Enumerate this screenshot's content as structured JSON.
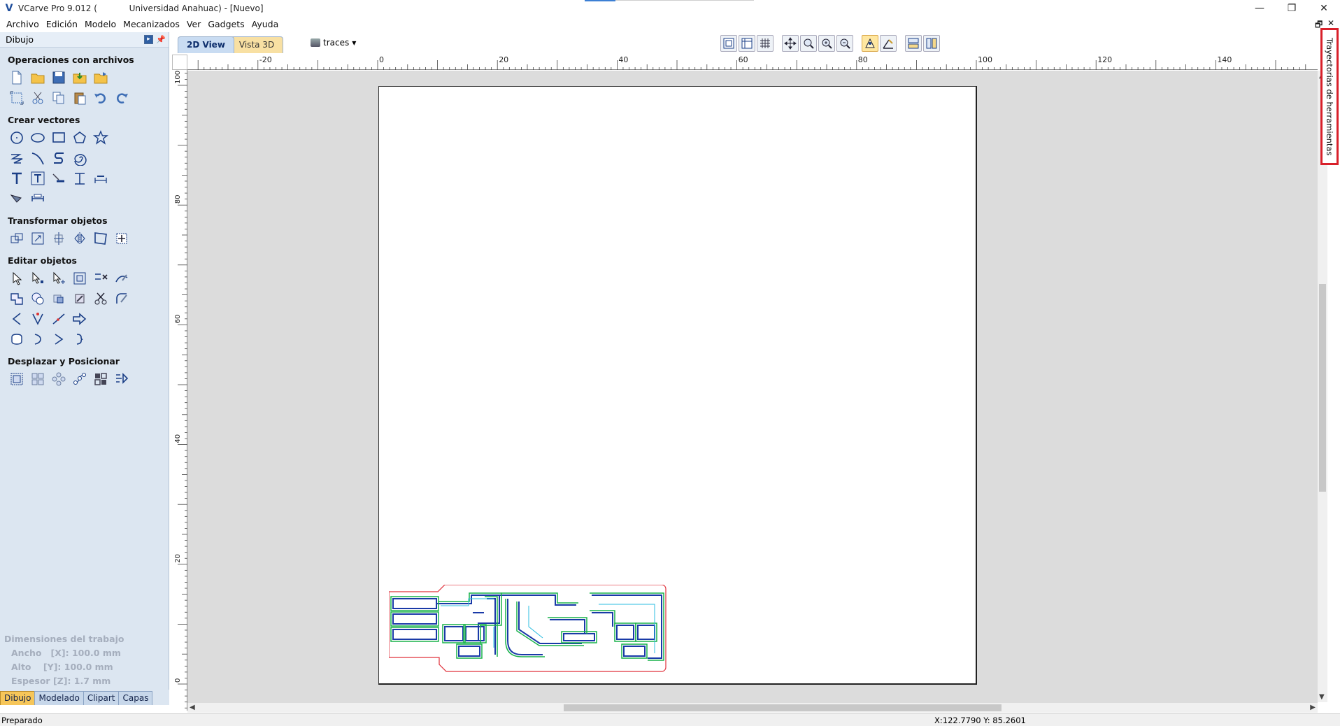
{
  "window": {
    "title": "VCarve Pro 9.012 (            Universidad Anahuac) - [Nuevo]",
    "minimize": "—",
    "maximize": "❐",
    "close": "✕"
  },
  "menu": {
    "items": [
      "Archivo",
      "Edición",
      "Modelo",
      "Mecanizados",
      "Ver",
      "Gadgets",
      "Ayuda"
    ],
    "restore": "🗗",
    "close": "✕"
  },
  "left_panel": {
    "title": "Dibujo",
    "sections": [
      {
        "title": "Operaciones con archivos"
      },
      {
        "title": "Crear vectores"
      },
      {
        "title": "Transformar objetos"
      },
      {
        "title": "Editar objetos"
      },
      {
        "title": "Desplazar y Posicionar"
      }
    ],
    "dimensions": {
      "title": "Dimensiones del trabajo",
      "width": "Ancho   [X]: 100.0 mm",
      "height": "Alto    [Y]: 100.0 mm",
      "thickness": "Espesor [Z]: 1.7 mm"
    },
    "tabs": [
      "Dibujo",
      "Modelado",
      "Clipart",
      "Capas"
    ]
  },
  "view_tabs": [
    "2D View",
    "Vista 3D"
  ],
  "layer": {
    "name": "traces"
  },
  "ruler": {
    "x_labels": [
      "-20",
      "0",
      "20",
      "40",
      "60",
      "80",
      "100",
      "120",
      "140"
    ],
    "y_labels": [
      "100",
      "80",
      "60",
      "40",
      "20",
      "0"
    ]
  },
  "right_tab": {
    "label": "Trayectorias de herramientas"
  },
  "status": {
    "text": "Preparado",
    "coords": "X:122.7790 Y: 85.2601"
  },
  "colors": {
    "panel": "#dce6f1",
    "canvas": "#dcdcdc",
    "highlight": "#d8202a",
    "trace_blue": "#1a3aa8",
    "trace_green": "#18b24a",
    "board_outline": "#e0303a"
  }
}
